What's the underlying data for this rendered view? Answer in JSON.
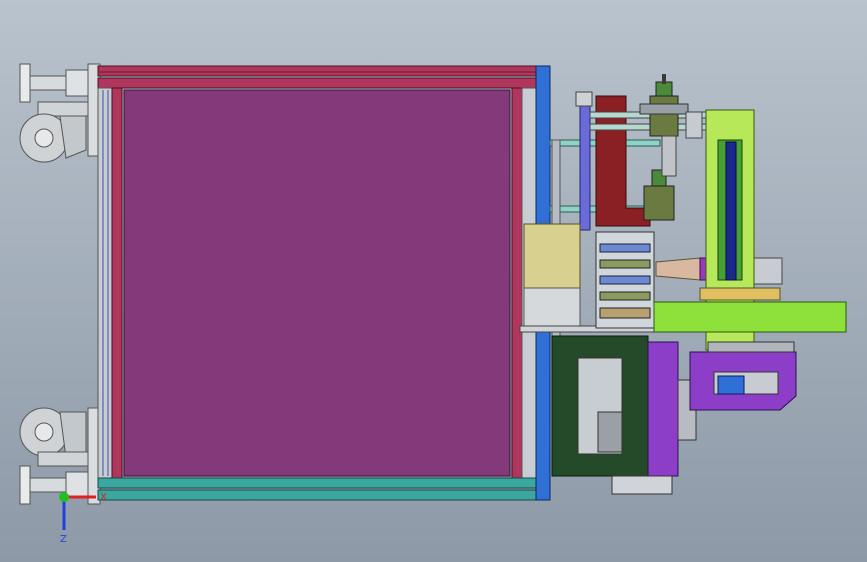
{
  "viewport": {
    "background_top": "#b9c3cd",
    "background_bottom": "#8d99a7"
  },
  "triad": {
    "x_label": "X",
    "z_label": "Z",
    "x_color": "#e02020",
    "y_color": "#20c020",
    "z_color": "#2040e0"
  },
  "colors": {
    "frame_magenta": "#b0365e",
    "panel_purple": "#843a7a",
    "column_blue": "#2f6fd6",
    "rail_teal": "#3aa7a0",
    "bracket_darkred": "#8a2024",
    "arm_lime": "#8ee03a",
    "base_darkgreen": "#244a2a",
    "motor_tan": "#d8d08e",
    "plate_violet": "#8c3ec8",
    "caster_grey": "#cfd3d6"
  }
}
